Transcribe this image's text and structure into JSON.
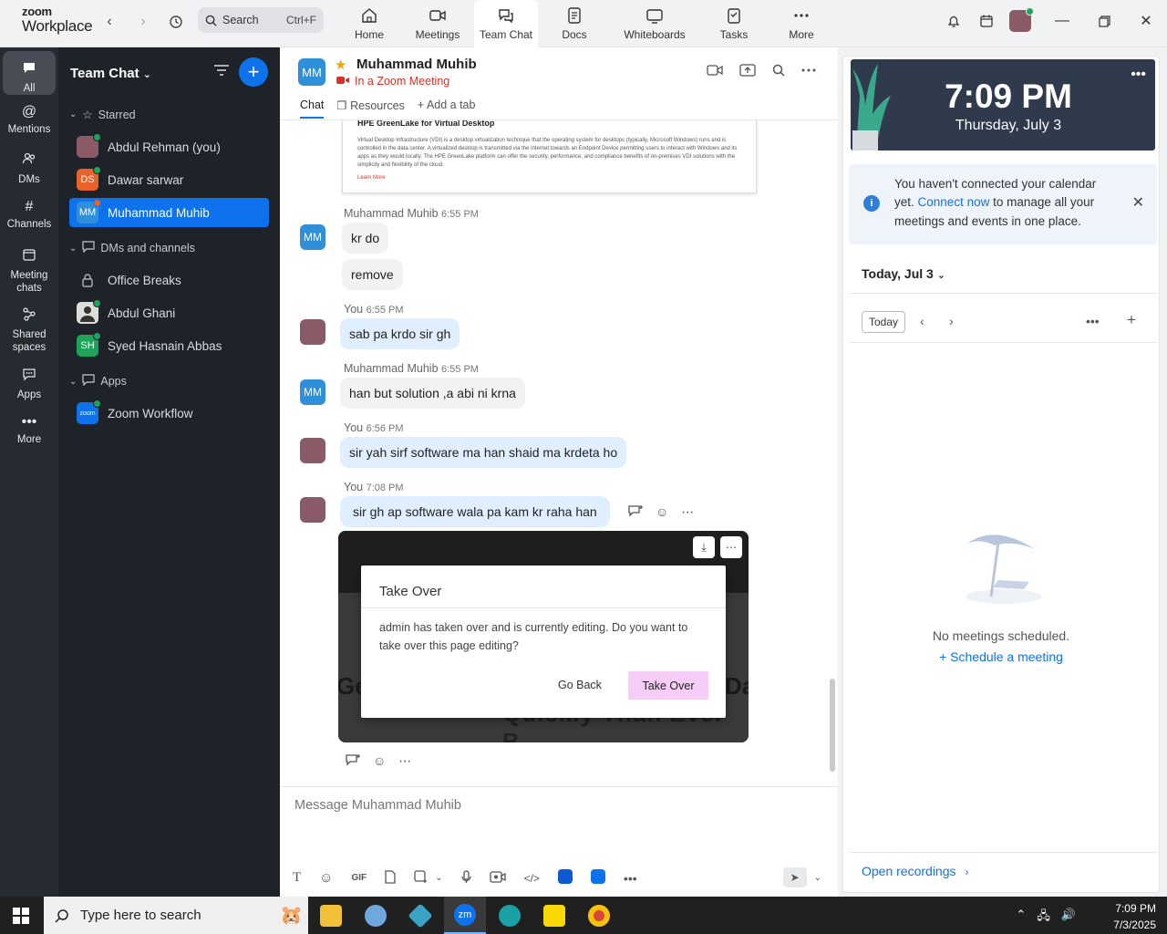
{
  "app": {
    "brand_line1": "zoom",
    "brand_line2": "Workplace",
    "search_placeholder": "Search",
    "search_shortcut": "Ctrl+F",
    "tabs": [
      {
        "label": "Home",
        "icon": "home-icon"
      },
      {
        "label": "Meetings",
        "icon": "video-icon"
      },
      {
        "label": "Team Chat",
        "icon": "chat-icon"
      },
      {
        "label": "Docs",
        "icon": "doc-icon"
      },
      {
        "label": "Whiteboards",
        "icon": "whiteboard-icon"
      },
      {
        "label": "Tasks",
        "icon": "tasks-icon"
      },
      {
        "label": "More",
        "icon": "more-icon"
      }
    ],
    "active_tab": "Team Chat"
  },
  "rail": {
    "items": [
      {
        "label": "All",
        "icon": "chat-bubble-icon"
      },
      {
        "label": "Mentions",
        "icon": "at-icon"
      },
      {
        "label": "DMs",
        "icon": "people-icon"
      },
      {
        "label": "Channels",
        "icon": "hash-icon"
      },
      {
        "label": "Meeting chats",
        "icon": "calendar-icon"
      },
      {
        "label": "Shared spaces",
        "icon": "share-icon"
      },
      {
        "label": "Apps",
        "icon": "apps-icon"
      },
      {
        "label": "More",
        "icon": "ellipsis-icon"
      }
    ]
  },
  "sidebar": {
    "title": "Team Chat",
    "sections": {
      "starred": "Starred",
      "dms": "DMs and channels",
      "apps": "Apps"
    },
    "starred": [
      {
        "name": "Abdul Rehman (you)",
        "initials": "",
        "color": "#8a5a66"
      },
      {
        "name": "Dawar sarwar",
        "initials": "DS",
        "color": "#e8622c"
      },
      {
        "name": "Muhammad Muhib",
        "initials": "MM",
        "color": "#2f8fd8"
      }
    ],
    "dms": [
      {
        "name": "Office Breaks",
        "initials": "",
        "color": ""
      },
      {
        "name": "Abdul Ghani",
        "initials": "",
        "color": "#555"
      },
      {
        "name": "Syed Hasnain Abbas",
        "initials": "SH",
        "color": "#1ea35a"
      }
    ],
    "apps": [
      {
        "name": "Zoom Workflow",
        "initials": "zoom",
        "color": "#0e72ed"
      }
    ]
  },
  "chat": {
    "name": "Muhammad Muhib",
    "initials": "MM",
    "status": "In a Zoom Meeting",
    "tabs": [
      "Chat",
      "Resources",
      "+ Add a tab"
    ],
    "attachment": {
      "title": "HPE GreenLake for Virtual Desktop",
      "body": "Virtual Desktop Infrastructure (VDI) is a desktop virtualization technique that the operating system for desktops (typically, Microsoft Windows) runs and is controlled in the data center. A virtualized desktop is transmitted via the internet towards an Endpoint Device permitting users to interact with Windows and its apps as they would locally. The HPE GreenLake platform can offer the security, performance, and compliance benefits of on-premises VDI solutions with the simplicity and flexibility of the cloud.",
      "more": "Learn More"
    },
    "messages": [
      {
        "sender": "Muhammad Muhib",
        "time": "6:55 PM",
        "texts": [
          "kr do",
          "remove"
        ]
      },
      {
        "sender": "You",
        "time": "6:55 PM",
        "texts": [
          "sab pa krdo sir gh"
        ]
      },
      {
        "sender": "Muhammad Muhib",
        "time": "6:55 PM",
        "texts": [
          "han but solution ,a abi ni krna"
        ]
      },
      {
        "sender": "You",
        "time": "6:56 PM",
        "texts": [
          "sir yah sirf software ma han shaid ma krdeta ho"
        ]
      },
      {
        "sender": "You",
        "time": "7:08 PM",
        "texts": [
          "sir gh ap software wala pa kam kr raha han"
        ]
      }
    ],
    "screenshot": {
      "bg_text_1": "Ge",
      "bg_text_2": "Da",
      "bg_text_3": "Quickly Than Ever B",
      "dialog_title": "Take Over",
      "dialog_body": "admin has taken over and is currently editing. Do you want to take over this page editing?",
      "dialog_back": "Go Back",
      "dialog_confirm": "Take Over"
    },
    "compose_placeholder": "Message Muhammad Muhib",
    "gif_label": "GIF"
  },
  "right_panel": {
    "time": "7:09 PM",
    "date": "Thursday, July 3",
    "notice_pre": "You haven't connected your calendar yet.",
    "notice_link": "Connect now",
    "notice_post": "to manage all your meetings and events in one place.",
    "today_header": "Today, Jul 3",
    "today_btn": "Today",
    "empty": "No meetings scheduled.",
    "schedule": "Schedule a meeting",
    "recordings": "Open recordings"
  },
  "taskbar": {
    "search": "Type here to search",
    "time": "7:09 PM",
    "date": "7/3/2025"
  }
}
